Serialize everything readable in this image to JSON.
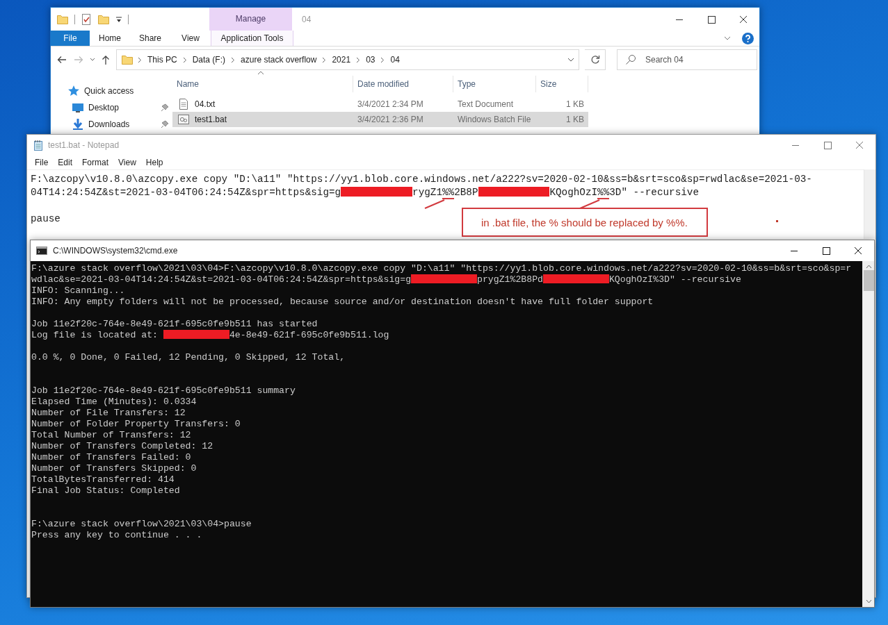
{
  "explorer": {
    "title": "04",
    "contextual_group": "Manage",
    "ribbon_tabs": [
      {
        "label": "File",
        "kind": "file"
      },
      {
        "label": "Home",
        "kind": "tab"
      },
      {
        "label": "Share",
        "kind": "tab"
      },
      {
        "label": "View",
        "kind": "tab"
      },
      {
        "label": "Application Tools",
        "kind": "contextual"
      }
    ],
    "breadcrumbs": [
      "This PC",
      "Data (F:)",
      "azure stack overflow",
      "2021",
      "03",
      "04"
    ],
    "search": {
      "placeholder": "Search 04"
    },
    "nav_items": [
      {
        "label": "Quick access",
        "kind": "star",
        "pinned": false
      },
      {
        "label": "Desktop",
        "kind": "desktop",
        "pinned": true
      },
      {
        "label": "Downloads",
        "kind": "download",
        "pinned": true
      }
    ],
    "columns": [
      "Name",
      "Date modified",
      "Type",
      "Size"
    ],
    "files": [
      {
        "name": "04.txt",
        "date_modified": "3/4/2021 2:34 PM",
        "type": "Text Document",
        "size": "1 KB",
        "kind": "text",
        "selected": false
      },
      {
        "name": "test1.bat",
        "date_modified": "3/4/2021 2:36 PM",
        "type": "Windows Batch File",
        "size": "1 KB",
        "kind": "batch",
        "selected": true
      }
    ]
  },
  "notepad": {
    "title": "test1.bat - Notepad",
    "menu": [
      "File",
      "Edit",
      "Format",
      "View",
      "Help"
    ],
    "lines": [
      {
        "kind": "text",
        "text": "F:\\azcopy\\v10.8.0\\azcopy.exe copy \"D:\\a11\" \"https://yy1.blob.core.windows.net/a222?sv=2020-02-10&ss=b&srt=sco&sp=rwdlac&se=2021-03-"
      },
      {
        "kind": "parts",
        "parts": [
          {
            "kind": "text",
            "text": "04T14:24:54Z&st=2021-03-04T06:24:54Z&spr=https&sig=g"
          },
          {
            "kind": "redacted"
          },
          {
            "kind": "text",
            "text": "rygZ1"
          },
          {
            "kind": "marked",
            "text": "%%"
          },
          {
            "kind": "text",
            "text": "2B8P"
          },
          {
            "kind": "redacted"
          },
          {
            "kind": "text",
            "text": "KQoghOzI"
          },
          {
            "kind": "marked",
            "text": "%%"
          },
          {
            "kind": "text",
            "text": "3D\" --recursive"
          }
        ]
      },
      {
        "kind": "blank"
      },
      {
        "kind": "text",
        "text": "pause"
      }
    ],
    "annotation": {
      "text": "in .bat file, the % should be replaced by %%."
    }
  },
  "cmd": {
    "title": "C:\\WINDOWS\\system32\\cmd.exe",
    "lines": [
      {
        "kind": "text",
        "text": "F:\\azure stack overflow\\2021\\03\\04>F:\\azcopy\\v10.8.0\\azcopy.exe copy \"D:\\a11\" \"https://yy1.blob.core.windows.net/a222?sv=2020-02-10&ss=b&srt=sco&sp=r"
      },
      {
        "kind": "parts",
        "parts": [
          {
            "kind": "text",
            "text": "wdlac&se=2021-03-04T14:24:54Z&st=2021-03-04T06:24:54Z&spr=https&sig=g"
          },
          {
            "kind": "redacted"
          },
          {
            "kind": "text",
            "text": "prygZ1%2B8Pd"
          },
          {
            "kind": "redacted"
          },
          {
            "kind": "text",
            "text": "KQoghOzI%3D\" --recursive"
          }
        ]
      },
      {
        "kind": "text",
        "text": "INFO: Scanning..."
      },
      {
        "kind": "text",
        "text": "INFO: Any empty folders will not be processed, because source and/or destination doesn't have full folder support"
      },
      {
        "kind": "blank"
      },
      {
        "kind": "text",
        "text": "Job 11e2f20c-764e-8e49-621f-695c0fe9b511 has started"
      },
      {
        "kind": "parts",
        "parts": [
          {
            "kind": "text",
            "text": "Log file is located at: "
          },
          {
            "kind": "redacted"
          },
          {
            "kind": "text",
            "text": "4e-8e49-621f-695c0fe9b511.log"
          }
        ]
      },
      {
        "kind": "blank"
      },
      {
        "kind": "text",
        "text": "0.0 %, 0 Done, 0 Failed, 12 Pending, 0 Skipped, 12 Total,"
      },
      {
        "kind": "blank"
      },
      {
        "kind": "blank"
      },
      {
        "kind": "text",
        "text": "Job 11e2f20c-764e-8e49-621f-695c0fe9b511 summary"
      },
      {
        "kind": "text",
        "text": "Elapsed Time (Minutes): 0.0334"
      },
      {
        "kind": "text",
        "text": "Number of File Transfers: 12"
      },
      {
        "kind": "text",
        "text": "Number of Folder Property Transfers: 0"
      },
      {
        "kind": "text",
        "text": "Total Number of Transfers: 12"
      },
      {
        "kind": "text",
        "text": "Number of Transfers Completed: 12"
      },
      {
        "kind": "text",
        "text": "Number of Transfers Failed: 0"
      },
      {
        "kind": "text",
        "text": "Number of Transfers Skipped: 0"
      },
      {
        "kind": "text",
        "text": "TotalBytesTransferred: 414"
      },
      {
        "kind": "text",
        "text": "Final Job Status: Completed"
      },
      {
        "kind": "blank"
      },
      {
        "kind": "blank"
      },
      {
        "kind": "text",
        "text": "F:\\azure stack overflow\\2021\\03\\04>pause"
      },
      {
        "kind": "text",
        "text": "Press any key to continue . . ."
      }
    ]
  }
}
